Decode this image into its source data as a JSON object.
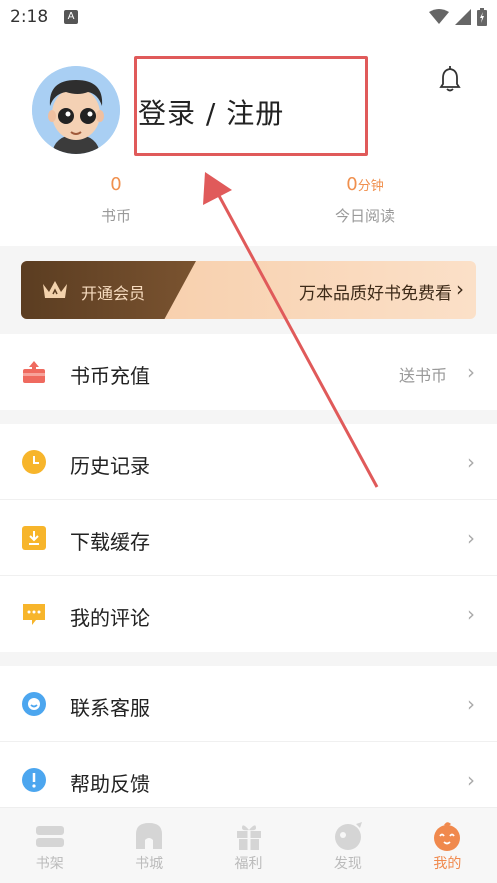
{
  "status": {
    "time": "2:18",
    "a_icon": "A"
  },
  "profile": {
    "login_label": "登录 / 注册",
    "coins_value": "0",
    "coins_label": "书币",
    "reading_value": "0",
    "reading_unit": "分钟",
    "reading_label": "今日阅读"
  },
  "vip": {
    "open_label": "开通会员",
    "promo_label": "万本品质好书免费看",
    "chevron": "›"
  },
  "menu_group1": [
    {
      "label": "书币充值",
      "extra": "送书币",
      "icon": "recharge-icon"
    }
  ],
  "menu_group2": [
    {
      "label": "历史记录",
      "icon": "clock-icon"
    },
    {
      "label": "下载缓存",
      "icon": "download-icon"
    },
    {
      "label": "我的评论",
      "icon": "comment-icon"
    }
  ],
  "menu_group3": [
    {
      "label": "联系客服",
      "icon": "service-icon"
    },
    {
      "label": "帮助反馈",
      "icon": "help-icon"
    }
  ],
  "arrow_glyph": "›",
  "tabs": [
    {
      "label": "书架",
      "icon": "bookshelf-icon",
      "active": false
    },
    {
      "label": "书城",
      "icon": "bookstore-icon",
      "active": false
    },
    {
      "label": "福利",
      "icon": "gift-icon",
      "active": false
    },
    {
      "label": "发现",
      "icon": "discover-icon",
      "active": false
    },
    {
      "label": "我的",
      "icon": "mine-icon",
      "active": true
    }
  ],
  "colors": {
    "accent": "#f0894d",
    "annotation": "#e05a5a",
    "vip_dark": "#5b3d21",
    "vip_light": "#f6c9a2"
  }
}
